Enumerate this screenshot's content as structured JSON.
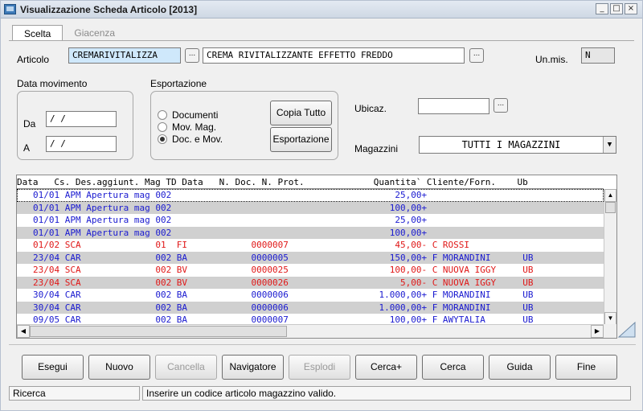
{
  "window": {
    "title": "Visualizzazione Scheda Articolo [2013]"
  },
  "tabs": [
    {
      "label": "Scelta",
      "active": true
    },
    {
      "label": "Giacenza",
      "active": false
    }
  ],
  "articolo": {
    "label": "Articolo",
    "code": "CREMARIVITALIZZA",
    "description": "CREMA RIVITALIZZANTE EFFETTO FREDDO",
    "lookup_label": "...",
    "unit_label": "Un.mis.",
    "unit_value": "N"
  },
  "data_movimento": {
    "title": "Data movimento",
    "from_label": "Da",
    "from_value": "  /  /",
    "to_label": "A",
    "to_value": "  /  /"
  },
  "esportazione": {
    "title": "Esportazione",
    "options": [
      {
        "label": "Documenti",
        "selected": false
      },
      {
        "label": "Mov. Mag.",
        "selected": false
      },
      {
        "label": "Doc. e Mov.",
        "selected": true
      }
    ],
    "copy_button": "Copia Tutto",
    "export_button": "Esportazione"
  },
  "ubicazione": {
    "label": "Ubicaz.",
    "value": "",
    "lookup_label": "..."
  },
  "magazzini": {
    "label": "Magazzini",
    "value": "TUTTI I MAGAZZINI"
  },
  "grid": {
    "header": "Data   Cs. Des.aggiunt. Mag TD Data   N. Doc. N. Prot.             Quantita` Cliente/Forn.    Ub",
    "rows": [
      {
        "text": "01/01 APM Apertura mag 002                                          25,00+",
        "color": "#1a1ad0",
        "alt": false,
        "selected": true
      },
      {
        "text": "01/01 APM Apertura mag 002                                         100,00+",
        "color": "#1a1ad0",
        "alt": true,
        "selected": false
      },
      {
        "text": "01/01 APM Apertura mag 002                                          25,00+",
        "color": "#1a1ad0",
        "alt": false,
        "selected": false
      },
      {
        "text": "01/01 APM Apertura mag 002                                         100,00+",
        "color": "#1a1ad0",
        "alt": true,
        "selected": false
      },
      {
        "text": "01/02 SCA              01  FI            0000007                    45,00- C ROSSI",
        "color": "#e01818",
        "alt": false,
        "selected": false
      },
      {
        "text": "23/04 CAR              002 BA            0000005                   150,00+ F MORANDINI      UB",
        "color": "#1a1ad0",
        "alt": true,
        "selected": false
      },
      {
        "text": "23/04 SCA              002 BV            0000025                   100,00- C NUOVA IGGY     UB",
        "color": "#e01818",
        "alt": false,
        "selected": false
      },
      {
        "text": "23/04 SCA              002 BV            0000026                     5,00- C NUOVA IGGY     UB",
        "color": "#e01818",
        "alt": true,
        "selected": false
      },
      {
        "text": "30/04 CAR              002 BA            0000006                 1.000,00+ F MORANDINI      UB",
        "color": "#1a1ad0",
        "alt": false,
        "selected": false
      },
      {
        "text": "30/04 CAR              002 BA            0000006                 1.000,00+ F MORANDINI      UB",
        "color": "#1a1ad0",
        "alt": true,
        "selected": false
      },
      {
        "text": "09/05 CAR              002 BA            0000007                   100,00+ F AWYTALIA       UB",
        "color": "#1a1ad0",
        "alt": false,
        "selected": false
      }
    ]
  },
  "actions": [
    {
      "label": "Esegui",
      "enabled": true
    },
    {
      "label": "Nuovo",
      "enabled": true
    },
    {
      "label": "Cancella",
      "enabled": false
    },
    {
      "label": "Navigatore",
      "enabled": true
    },
    {
      "label": "Esplodi",
      "enabled": false
    },
    {
      "label": "Cerca+",
      "enabled": true
    },
    {
      "label": "Cerca",
      "enabled": true
    },
    {
      "label": "Guida",
      "enabled": true
    },
    {
      "label": "Fine",
      "enabled": true
    }
  ],
  "status": {
    "mode": "Ricerca",
    "message": "Inserire un codice articolo magazzino valido."
  },
  "colors": {
    "positive_row": "#1a1ad0",
    "negative_row": "#e01818",
    "highlight_field": "#cfe8fb"
  }
}
